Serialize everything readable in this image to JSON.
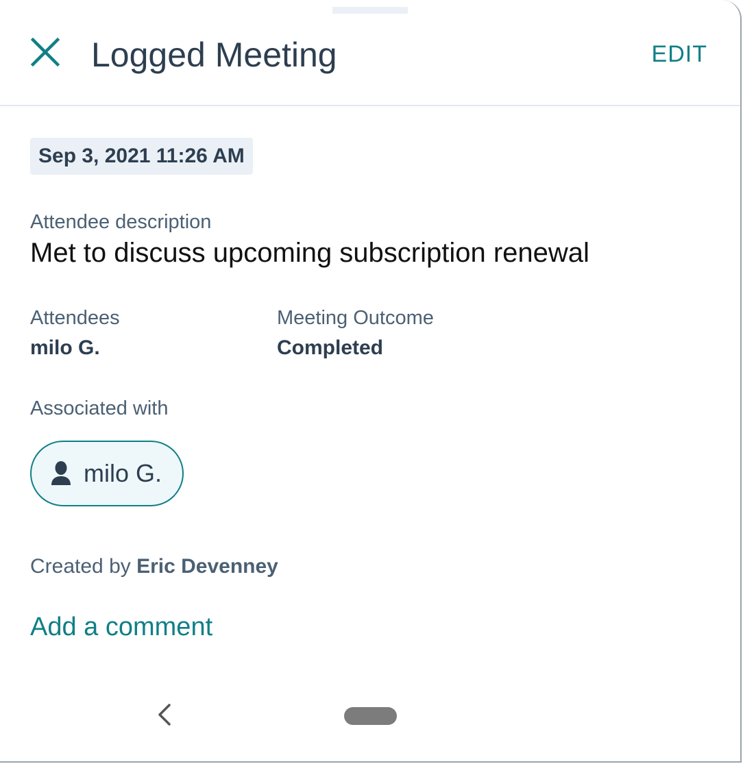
{
  "header": {
    "close_icon": "close-icon",
    "title": "Logged Meeting",
    "edit_label": "EDIT"
  },
  "meeting": {
    "datetime": "Sep 3, 2021 11:26 AM",
    "description_label": "Attendee description",
    "description": "Met to discuss upcoming subscription renewal",
    "attendees_label": "Attendees",
    "attendees_value": "milo G.",
    "outcome_label": "Meeting Outcome",
    "outcome_value": "Completed",
    "associated_label": "Associated with",
    "associated": [
      {
        "icon": "contact-person-icon",
        "label": "milo G."
      }
    ],
    "created_by_prefix": "Created by",
    "created_by_name": "Eric Devenney",
    "add_comment": "Add a comment"
  },
  "nav": {
    "back_icon": "back-chevron-icon",
    "home_icon": "home-pill-icon"
  },
  "colors": {
    "accent": "#0f7f86",
    "heading": "#2d3e50",
    "label": "#4b6073",
    "chip_bg": "#eaf0f6"
  }
}
